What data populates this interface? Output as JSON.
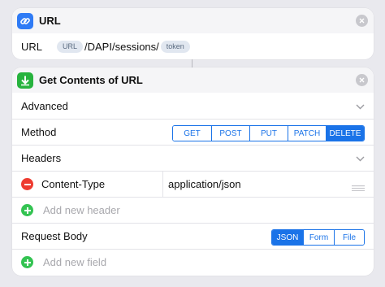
{
  "url_action": {
    "title": "URL",
    "icon": "link-icon",
    "icon_color": "#2f7bf5",
    "field_label": "URL",
    "segments": {
      "token_url": "URL",
      "path_text": "/DAPI/sessions/",
      "token_token": "token"
    }
  },
  "get_contents_action": {
    "title": "Get Contents of URL",
    "icon": "download-arrow-icon",
    "icon_color": "#27b33e",
    "advanced_label": "Advanced",
    "method": {
      "label": "Method",
      "options": [
        "GET",
        "POST",
        "PUT",
        "PATCH",
        "DELETE"
      ],
      "selected": "DELETE"
    },
    "headers": {
      "label": "Headers",
      "items": [
        {
          "key": "Content-Type",
          "value": "application/json"
        }
      ],
      "add_placeholder": "Add new header"
    },
    "request_body": {
      "label": "Request Body",
      "options": [
        "JSON",
        "Form",
        "File"
      ],
      "selected": "JSON",
      "add_placeholder": "Add new field"
    }
  },
  "colors": {
    "accent": "#1a73e8",
    "remove": "#ee3b30",
    "add": "#33c351"
  }
}
